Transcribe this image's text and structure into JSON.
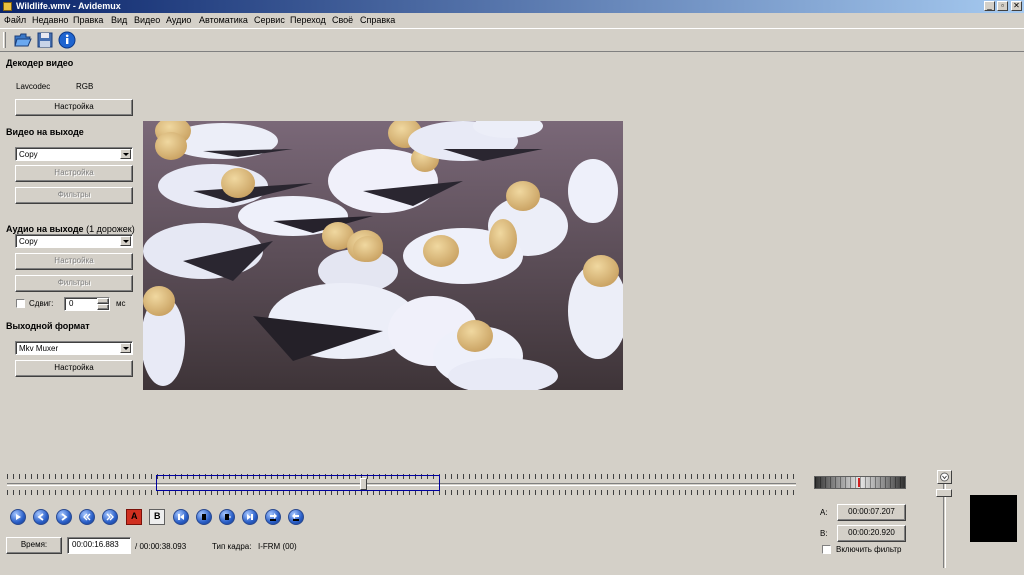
{
  "window": {
    "title": "Wildlife.wmv - Avidemux",
    "minimize_glyph": "_",
    "restore_glyph": "▫",
    "close_glyph": "✕"
  },
  "menu": [
    "Файл",
    "Недавно",
    "Правка",
    "Вид",
    "Видео",
    "Аудио",
    "Автоматика",
    "Сервис",
    "Переход",
    "Своё",
    "Справка"
  ],
  "toolbar": {
    "icons": [
      "open-folder-icon",
      "save-disk-icon",
      "info-icon"
    ]
  },
  "left_panel": {
    "video_decoder": {
      "title": "Декодер видео",
      "codec": "Lavcodec",
      "colorspace": "RGB",
      "configure_label": "Настройка"
    },
    "video_output": {
      "title": "Видео на выходе",
      "selected": "Copy",
      "configure_label": "Настройка",
      "filters_label": "Фильтры"
    },
    "audio_output": {
      "title": "Аудио на выходе",
      "tracks_note": "(1 дорожек)",
      "selected": "Copy",
      "configure_label": "Настройка",
      "filters_label": "Фильтры",
      "shift_label": "Сдвиг:",
      "shift_value": "0",
      "shift_unit": "мс"
    },
    "output_format": {
      "title": "Выходной формат",
      "selected": "Mkv Muxer",
      "configure_label": "Настройка"
    }
  },
  "bottom_bar": {
    "time_button": "Время:",
    "current_time": "00:00:16.883",
    "total_time": "/ 00:00:38.093",
    "frame_type_label": "Тип кадра:",
    "frame_type_value": "I-FRM (00)"
  },
  "navigation_buttons": [
    "play",
    "previous-frame",
    "next-frame",
    "previous-keyframe",
    "next-keyframe",
    "set-marker-a",
    "set-marker-b",
    "go-to-start",
    "previous-black",
    "next-black",
    "go-to-end",
    "go-to-marker-a",
    "go-to-marker-b"
  ],
  "marker_labels": {
    "a": "A",
    "b": "B"
  },
  "selection": {
    "a_label": "A:",
    "a_time": "00:00:07.207",
    "b_label": "B:",
    "b_time": "00:00:20.920",
    "filter_checkbox": "Включить фильтр"
  },
  "timeline": {
    "position_fraction": 0.443,
    "selection_start_fraction": 0.189,
    "selection_end_fraction": 0.549
  },
  "colors": {
    "window_bg": "#d4d0c8",
    "title_bar": "#0a246a",
    "selection_border": "#0000a0",
    "nav_button": "#2a5fc8",
    "marker_a": "#d03020"
  }
}
